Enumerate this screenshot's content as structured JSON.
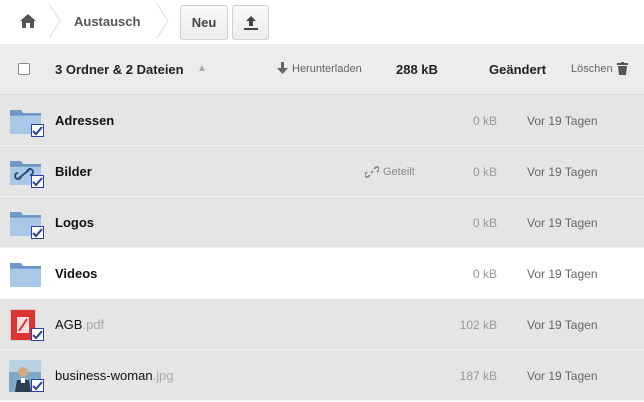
{
  "breadcrumb": {
    "current": "Austausch"
  },
  "toolbar": {
    "new_label": "Neu"
  },
  "header": {
    "summary": "3 Ordner & 2 Dateien",
    "sort_indicator": "▲",
    "download_label": "Herunterladen",
    "total_size": "288 kB",
    "modified_label": "Geändert",
    "delete_label": "Löschen"
  },
  "files": [
    {
      "name": "Adressen",
      "ext": "",
      "type": "folder",
      "shared": "",
      "size": "0 kB",
      "modified": "Vor 19 Tagen",
      "selected": true
    },
    {
      "name": "Bilder",
      "ext": "",
      "type": "folder-shared",
      "shared": "Geteilt",
      "size": "0 kB",
      "modified": "Vor 19 Tagen",
      "selected": true
    },
    {
      "name": "Logos",
      "ext": "",
      "type": "folder",
      "shared": "",
      "size": "0 kB",
      "modified": "Vor 19 Tagen",
      "selected": true
    },
    {
      "name": "Videos",
      "ext": "",
      "type": "folder",
      "shared": "",
      "size": "0 kB",
      "modified": "Vor 19 Tagen",
      "selected": false
    },
    {
      "name": "AGB",
      "ext": ".pdf",
      "type": "pdf",
      "shared": "",
      "size": "102 kB",
      "modified": "Vor 19 Tagen",
      "selected": true
    },
    {
      "name": "business-woman",
      "ext": ".jpg",
      "type": "image",
      "shared": "",
      "size": "187 kB",
      "modified": "Vor 19 Tagen",
      "selected": true
    }
  ],
  "colors": {
    "header_bg": "#ececec",
    "row_selected_bg": "#e5e5e5",
    "check_blue": "#2a3fa8",
    "folder_blue": "#8fb4dc"
  }
}
